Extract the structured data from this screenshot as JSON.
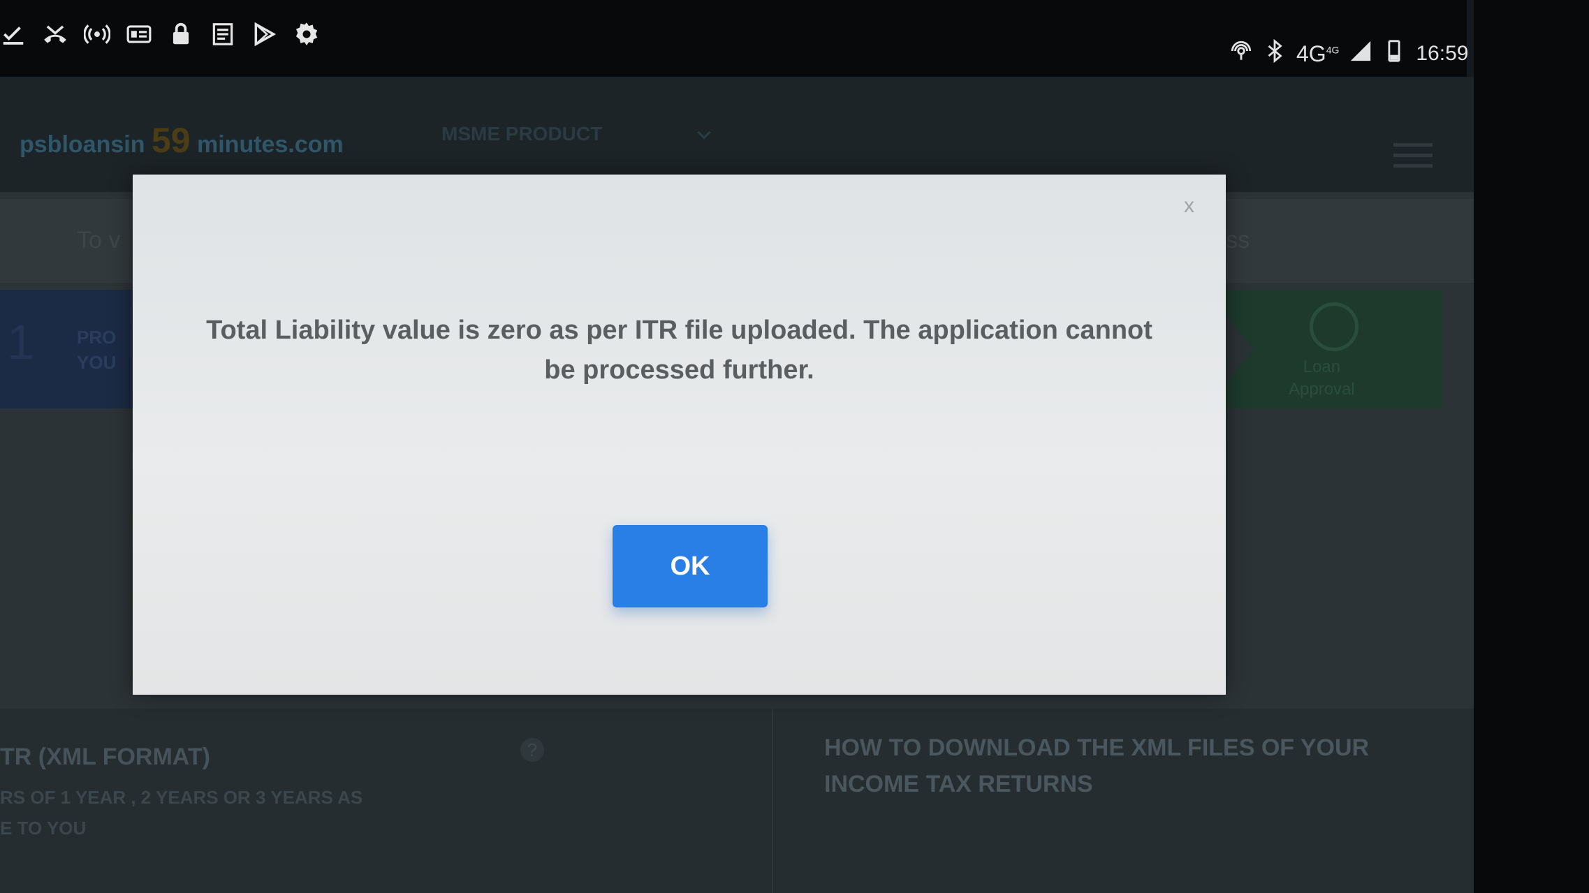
{
  "status_bar": {
    "left_icons": [
      "download-done-icon",
      "missed-call-icon",
      "hotspot-icon",
      "gst-app-icon",
      "lock-icon",
      "news-icon",
      "play-store-icon",
      "settings-icon"
    ],
    "network": "4G",
    "network_sup": "4G",
    "time": "16:59"
  },
  "background_page": {
    "brand_prefix": "psbloansin",
    "brand_number": "59",
    "brand_suffix": "minutes.com",
    "nav_item": "MSME PRODUCT",
    "info_left": "To v",
    "info_right": "ress",
    "step_first_number": "1",
    "step_first_label_line1": "PRO",
    "step_first_label_line2": "YOU",
    "step_last_label_line1": "Loan",
    "step_last_label_line2": "Approval",
    "lower_left_title": "TR (XML FORMAT)",
    "lower_left_sub_line1": "RS OF 1 YEAR , 2 YEARS OR 3 YEARS AS",
    "lower_left_sub_line2": "E TO YOU",
    "help_glyph": "?",
    "lower_right_title": "HOW TO DOWNLOAD THE XML FILES OF YOUR INCOME TAX RETURNS"
  },
  "dialog": {
    "close_label": "x",
    "message": "Total Liability value is zero as per ITR file uploaded. The application cannot be processed further.",
    "ok_label": "OK"
  },
  "colors": {
    "ok_button": "#2a7fe6",
    "dialog_bg": "#e6e9ea",
    "message_text": "#5a5e60"
  }
}
